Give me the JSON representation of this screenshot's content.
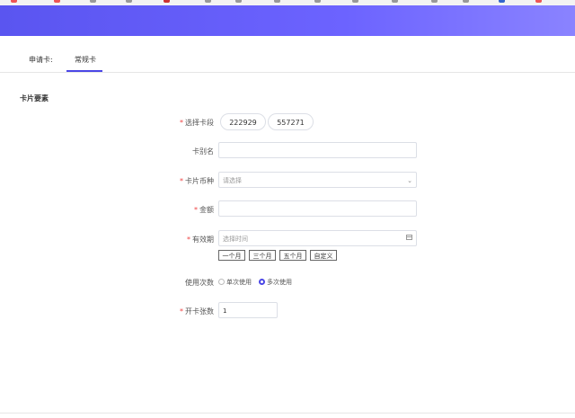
{
  "tabs": [
    "申请卡:",
    "常规卡"
  ],
  "section_title": "卡片要素",
  "fields": {
    "card_segment": {
      "label": "选择卡段",
      "options": [
        "222929",
        "557271"
      ]
    },
    "card_alias": {
      "label": "卡别名",
      "value": ""
    },
    "currency": {
      "label": "卡片币种",
      "placeholder": "请选择"
    },
    "amount": {
      "label": "金额",
      "value": ""
    },
    "validity": {
      "label": "有效期",
      "placeholder": "选择时间",
      "quick": [
        "一个月",
        "三个月",
        "五个月",
        "自定义"
      ]
    },
    "usage": {
      "label": "使用次数",
      "options": [
        "单次使用",
        "多次使用"
      ],
      "selected": "多次使用"
    },
    "count": {
      "label": "开卡张数",
      "value": "1"
    }
  },
  "colors": {
    "accent": "#4b47e6",
    "banner": "#6c63ff",
    "required": "#e44444"
  }
}
